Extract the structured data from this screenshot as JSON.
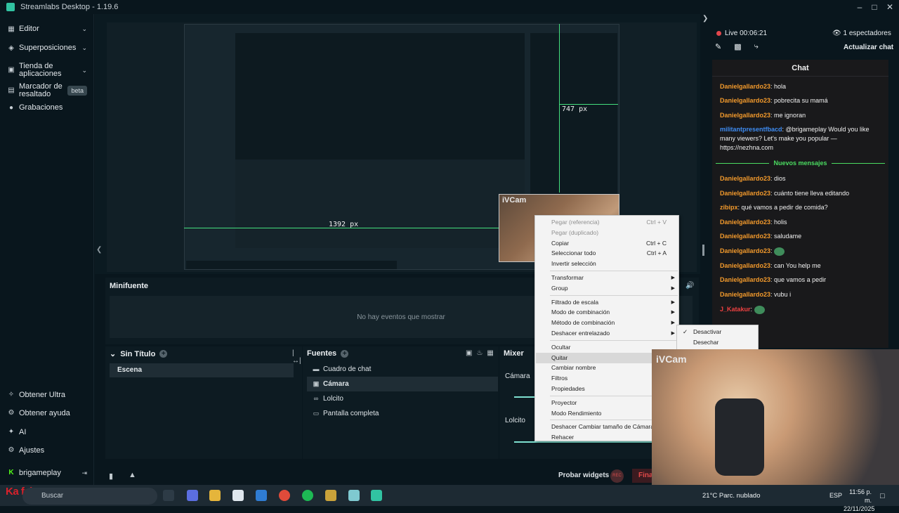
{
  "window": {
    "title": "Streamlabs Desktop - 1.19.6"
  },
  "nav": {
    "items": [
      {
        "label": "Editor",
        "icon": "editor-icon",
        "has_chevron": true
      },
      {
        "label": "Superposiciones",
        "icon": "overlays-icon",
        "has_chevron": true
      },
      {
        "label": "Tienda de aplicaciones",
        "icon": "app-store-icon",
        "has_chevron": true
      },
      {
        "label": "Marcador de resaltado",
        "icon": "highlighter-icon",
        "badge": "beta"
      },
      {
        "label": "Grabaciones",
        "icon": "recordings-icon"
      }
    ],
    "bottom": [
      {
        "label": "Obtener Ultra",
        "icon": "ultra-icon"
      },
      {
        "label": "Obtener ayuda",
        "icon": "help-icon"
      },
      {
        "label": "AI",
        "icon": "ai-icon"
      },
      {
        "label": "Ajustes",
        "icon": "settings-icon"
      }
    ],
    "user": {
      "name": "brigameplay"
    }
  },
  "preview": {
    "width_label": "1392 px",
    "height_label": "747 px"
  },
  "minifuente": {
    "title": "Minifuente",
    "empty": "No hay eventos que mostrar"
  },
  "scenes": {
    "title": "Sin Título",
    "selected": "Escena"
  },
  "sources": {
    "title": "Fuentes",
    "items": [
      {
        "label": "Cuadro de chat",
        "icon": "chat-box-icon",
        "selected": false
      },
      {
        "label": "Cámara",
        "icon": "camera-icon",
        "selected": true
      },
      {
        "label": "Lolcito",
        "icon": "link-icon",
        "selected": false
      },
      {
        "label": "Pantalla completa",
        "icon": "monitor-icon",
        "selected": false
      }
    ]
  },
  "mixer": {
    "title": "Mixer",
    "rows": [
      "Cámara",
      "Lolcito"
    ]
  },
  "status": {
    "test_widgets": "Probar widgets",
    "rec": "REC",
    "end": "Fina"
  },
  "stream": {
    "live": "Live 00:06:21",
    "viewers": "1 espectadores",
    "refresh": "Actualizar chat"
  },
  "chat": {
    "title": "Chat",
    "new_messages": "Nuevos mensajes",
    "before": [
      {
        "user": "Danielgallardo23",
        "text": "hola",
        "color": "orange"
      },
      {
        "user": "Danielgallardo23",
        "text": "pobrecita su mamá",
        "color": "orange"
      },
      {
        "user": "Danielgallardo23",
        "text": "me ignoran",
        "color": "orange"
      },
      {
        "user": "militantpresentfbacd",
        "text": "@brigameplay Would you like many viewers? Let's make you popular — https://nezhna.com",
        "color": "blue"
      }
    ],
    "after": [
      {
        "user": "Danielgallardo23",
        "text": "dios",
        "color": "orange"
      },
      {
        "user": "Danielgallardo23",
        "text": "cuánto tiene lleva editando",
        "color": "orange"
      },
      {
        "user": "zibipx",
        "text": "qué vamos a pedir de comida?",
        "color": "orange"
      },
      {
        "user": "Danielgallardo23",
        "text": "holis",
        "color": "orange"
      },
      {
        "user": "Danielgallardo23",
        "text": "saludame",
        "color": "orange"
      },
      {
        "user": "Danielgallardo23",
        "text": "",
        "color": "orange",
        "emoji": true
      },
      {
        "user": "Danielgallardo23",
        "text": "can You help me",
        "color": "orange"
      },
      {
        "user": "Danielgallardo23",
        "text": "que vamos a pedir",
        "color": "orange"
      },
      {
        "user": "Danielgallardo23",
        "text": "vubu i",
        "color": "orange"
      },
      {
        "user": "J_Katakur",
        "text": "",
        "color": "red",
        "emoji": true
      }
    ]
  },
  "context_menu": {
    "items": [
      {
        "label": "Pegar (referencia)",
        "shortcut": "Ctrl + V",
        "disabled": true
      },
      {
        "label": "Pegar (duplicado)",
        "disabled": true
      },
      {
        "label": "Copiar",
        "shortcut": "Ctrl + C"
      },
      {
        "label": "Seleccionar todo",
        "shortcut": "Ctrl + A"
      },
      {
        "label": "Invertir selección"
      },
      {
        "sep": true
      },
      {
        "label": "Transformar",
        "submenu": true
      },
      {
        "label": "Group",
        "submenu": true
      },
      {
        "sep": true
      },
      {
        "label": "Filtrado de escala",
        "submenu": true
      },
      {
        "label": "Modo de combinación",
        "submenu": true
      },
      {
        "label": "Método de combinación",
        "submenu": true
      },
      {
        "label": "Deshacer entrelazado",
        "submenu": true
      },
      {
        "sep": true
      },
      {
        "label": "Ocultar"
      },
      {
        "label": "Quitar",
        "highlighted": true
      },
      {
        "label": "Cambiar nombre"
      },
      {
        "label": "Filtros"
      },
      {
        "label": "Propiedades"
      },
      {
        "sep": true
      },
      {
        "label": "Proyector"
      },
      {
        "label": "Modo Rendimiento"
      },
      {
        "sep": true
      },
      {
        "label": "Deshacer Cambiar tamaño de Cámara"
      },
      {
        "label": "Rehacer"
      }
    ],
    "submenu": [
      {
        "label": "Desactivar",
        "checked": true
      },
      {
        "label": "Desechar",
        "checked": false
      }
    ]
  },
  "webcam": {
    "label": "iVCam"
  },
  "taskbar": {
    "search": "Buscar",
    "weather": "21°C  Parc. nublado",
    "lang": "ESP",
    "time": "11:56 p. m.",
    "date": "22/11/2025",
    "brand": "Ka faku..."
  }
}
